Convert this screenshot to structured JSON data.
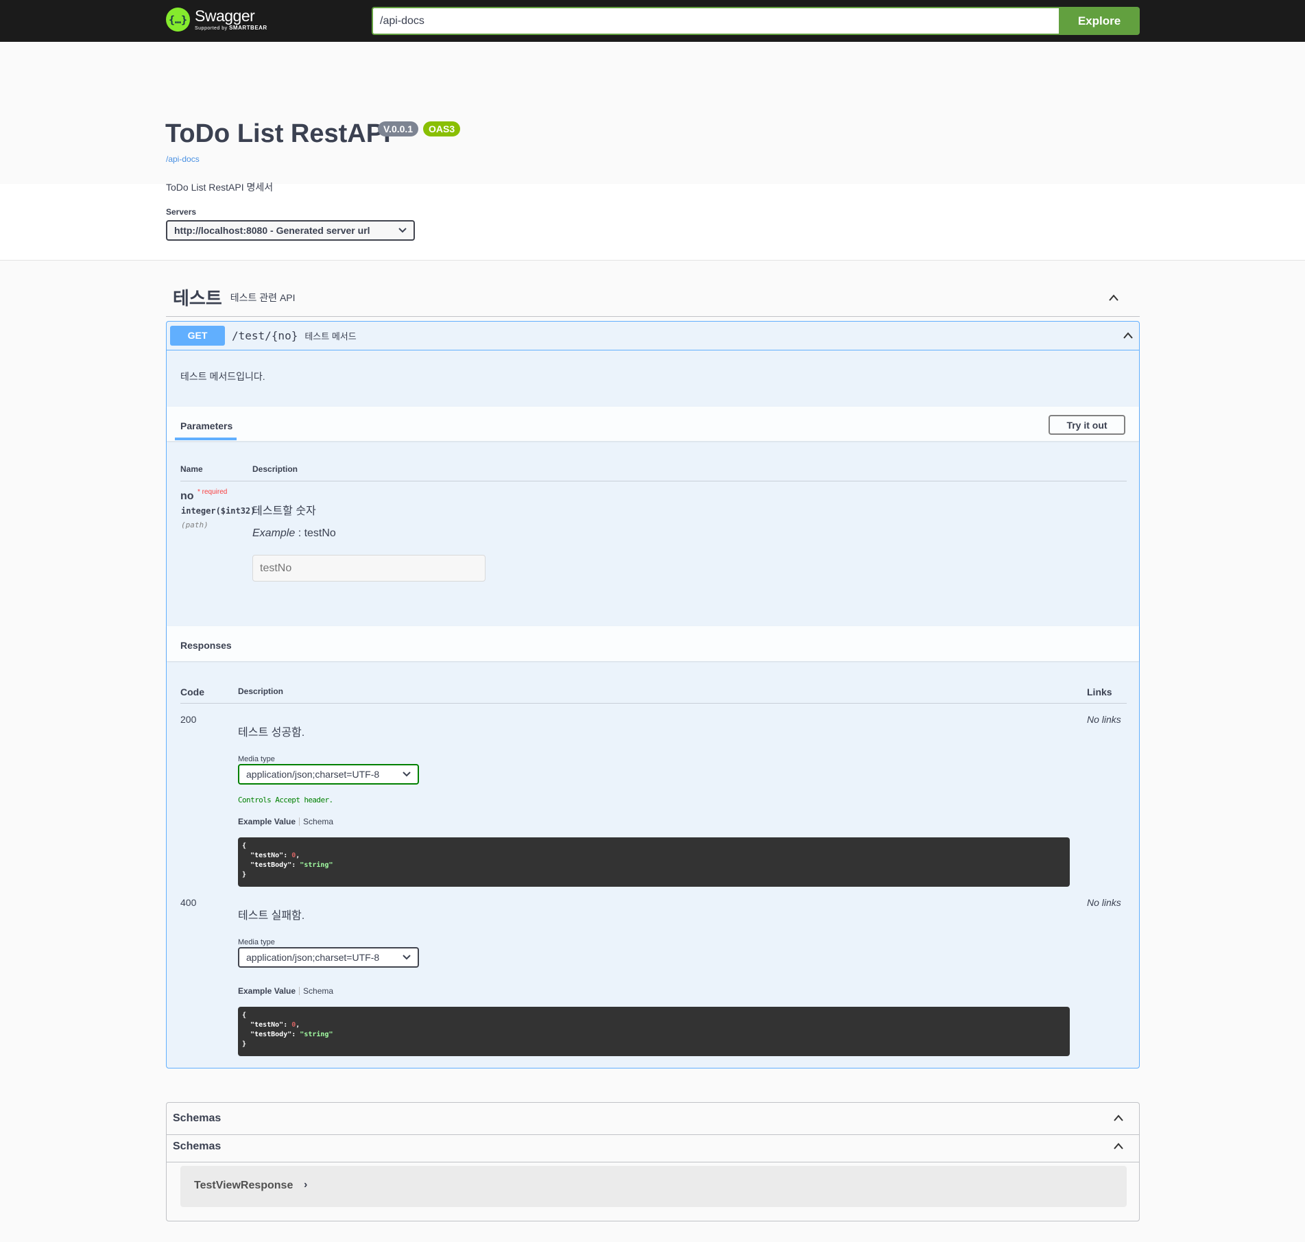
{
  "topbar": {
    "logo_name": "Swagger",
    "logo_sub_prefix": "Supported by ",
    "logo_sub_brand": "SMARTBEAR",
    "url_value": "/api-docs",
    "explore_label": "Explore",
    "accent_color": "#62a03f"
  },
  "info": {
    "title": "ToDo List RestAPI",
    "version_badge": "V.0.0.1",
    "oas_badge": "OAS3",
    "link": "/api-docs",
    "description": "ToDo List RestAPI 명세서"
  },
  "servers": {
    "label": "Servers",
    "selected": "http://localhost:8080 - Generated server url"
  },
  "tag": {
    "name": "테스트",
    "description": "테스트 관련 API"
  },
  "operation": {
    "method": "GET",
    "method_color": "#61affe",
    "path": "/test/{no}",
    "summary": "테스트 메서드",
    "description": "테스트 메서드입니다.",
    "params_tab": "Parameters",
    "try_label": "Try it out",
    "param_columns": {
      "name": "Name",
      "description": "Description"
    },
    "param": {
      "name": "no",
      "required_mark": "* required",
      "type": "integer($int32)",
      "in": "(path)",
      "description": "테스트할 숫자",
      "example_label": "Example",
      "example_value": " : testNo",
      "placeholder": "testNo"
    },
    "responses_title": "Responses",
    "resp_columns": {
      "code": "Code",
      "description": "Description",
      "links": "Links"
    },
    "responses": [
      {
        "code": "200",
        "description": "테스트 성공함.",
        "links": "No links",
        "media_label": "Media type",
        "media_value": "application/json;charset=UTF-8",
        "controls_note": "Controls Accept header.",
        "example_tab": "Example Value",
        "schema_tab": "Schema"
      },
      {
        "code": "400",
        "description": "테스트 실패함.",
        "links": "No links",
        "media_label": "Media type",
        "media_value": "application/json;charset=UTF-8",
        "example_tab": "Example Value",
        "schema_tab": "Schema"
      }
    ],
    "example_json": {
      "open": "{",
      "key1": "  \"testNo\": ",
      "val1": "0",
      "comma": ",",
      "key2": "  \"testBody\": ",
      "val2": "\"string\"",
      "close": "}"
    }
  },
  "models": {
    "title": "Schemas",
    "subtitle": "Schemas",
    "items": [
      {
        "name": "TestViewResponse",
        "arrow": "›"
      }
    ]
  },
  "icons": {
    "logo": "swagger-logo-icon",
    "chevron_up": "chevron-up-icon",
    "chevron_down": "chevron-down-icon"
  }
}
